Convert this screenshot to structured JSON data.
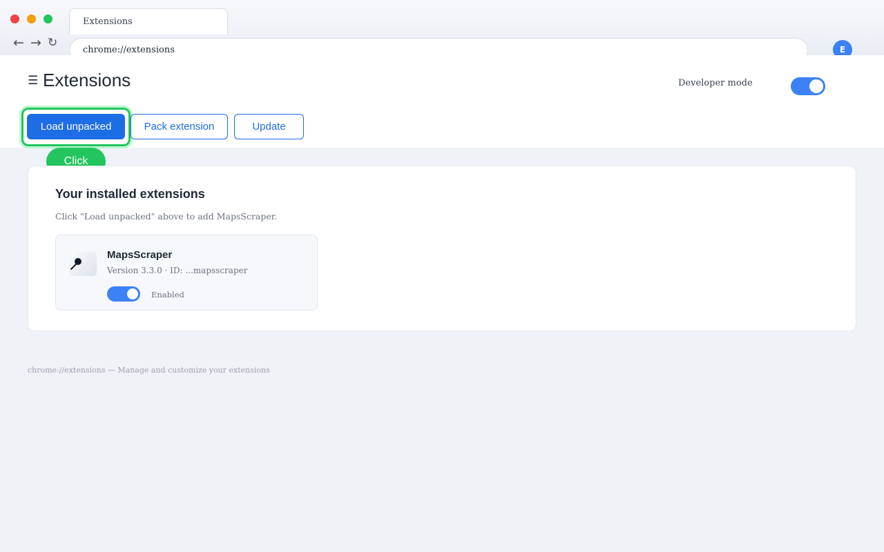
{
  "browser": {
    "tab_title": "Extensions",
    "address": "chrome://extensions",
    "profile_initial": "E",
    "nav": {
      "back": "←",
      "forward": "→",
      "reload": "↻"
    }
  },
  "header": {
    "menu_glyph": "☰",
    "title": "Extensions",
    "developer_mode_label": "Developer mode",
    "developer_mode_on": true
  },
  "toolbar": {
    "load_unpacked": "Load unpacked",
    "pack_extension": "Pack extension",
    "update": "Update",
    "highlighted_button": "Load unpacked",
    "click_hint": "Click"
  },
  "installed": {
    "title": "Your installed extensions",
    "subtitle": "Click \"Load unpacked\" above to add MapsScraper.",
    "extension": {
      "name": "MapsScraper",
      "meta": "Version 3.3.0 · ID: ...mapsscraper",
      "status": "Enabled",
      "enabled": true,
      "icon": "pin-icon"
    }
  },
  "footer": "chrome://extensions — Manage and customize your extensions",
  "colors": {
    "accent": "#1d6de6",
    "toggle": "#3b82f6",
    "highlight": "#22c55e"
  }
}
